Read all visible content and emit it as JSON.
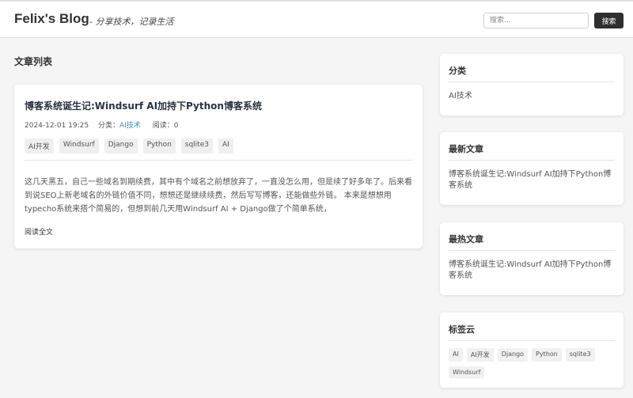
{
  "header": {
    "site_title": "Felix's Blog",
    "slogan": "- 分享技术，记录生活",
    "search_placeholder": "搜索...",
    "search_button": "搜索"
  },
  "main": {
    "heading": "文章列表",
    "post": {
      "title": "博客系统诞生记:Windsurf AI加持下Python博客系统",
      "date": "2024-12-01 19:25",
      "category_label": "分类：",
      "category": "AI技术",
      "views_label": "阅读：",
      "views": "0",
      "tags": [
        "AI开发",
        "Windsurf",
        "Django",
        "Python",
        "sqlite3",
        "AI"
      ],
      "excerpt": "这几天黑五，自己一些域名到期续费，其中有个域名之前想放弃了，一直没怎么用，但是续了好多年了。后来看到说SEO上新老域名的外链价值不同，想想还是继续续费，然后写写博客，还能做些外链。 本来是想想用typecho系统来搭个简易的，但想到前几天用Windsurf AI + Django做了个简单系统，",
      "read_more": "阅读全文"
    }
  },
  "sidebar": {
    "categories": {
      "title": "分类",
      "items": [
        "AI技术"
      ]
    },
    "latest": {
      "title": "最新文章",
      "items": [
        "博客系统诞生记:Windsurf AI加持下Python博客系统"
      ]
    },
    "popular": {
      "title": "最热文章",
      "items": [
        "博客系统诞生记:Windsurf AI加持下Python博客系统"
      ]
    },
    "tag_cloud": {
      "title": "标签云",
      "tags": [
        "AI",
        "AI开发",
        "Django",
        "Python",
        "sqlite3",
        "Windsurf"
      ]
    }
  }
}
